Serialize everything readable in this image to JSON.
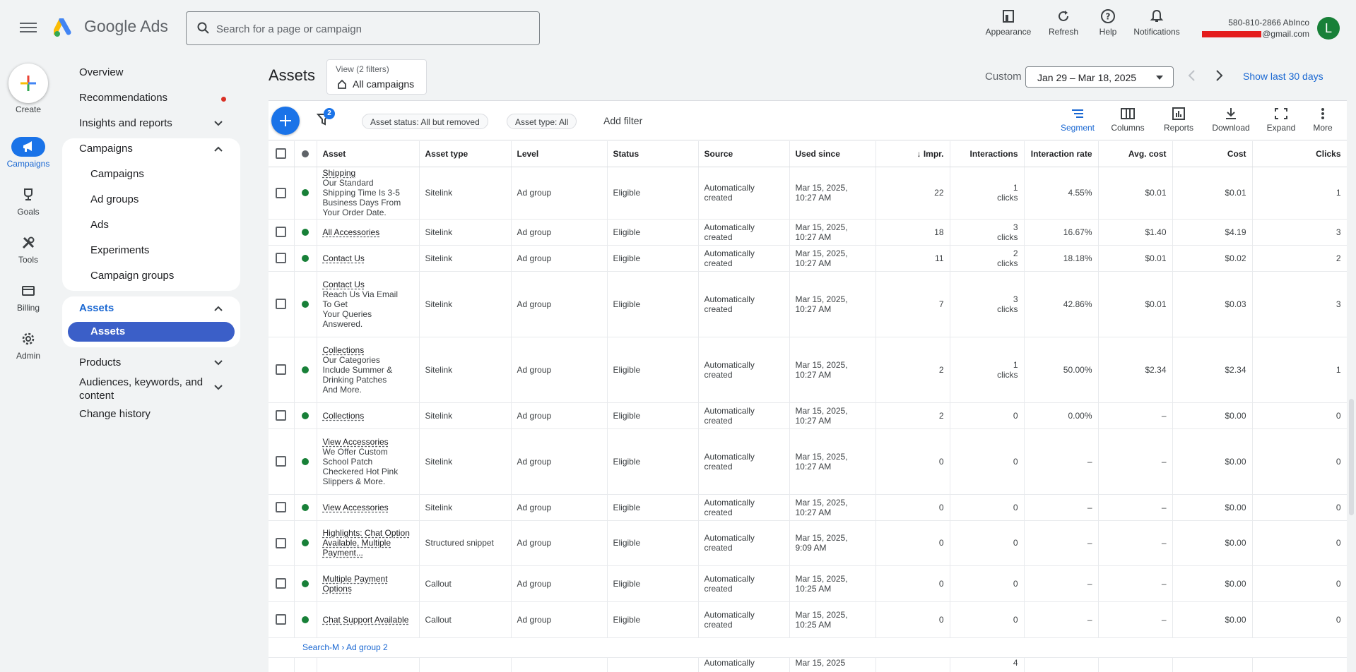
{
  "header": {
    "brand": "Google Ads",
    "search_placeholder": "Search for a page or campaign",
    "buttons": [
      {
        "label": "Appearance",
        "icon": "appearance-icon"
      },
      {
        "label": "Refresh",
        "icon": "refresh-icon"
      },
      {
        "label": "Help",
        "icon": "help-icon"
      },
      {
        "label": "Notifications",
        "icon": "bell-icon"
      }
    ],
    "account_name": "580-810-2866 AbInco",
    "account_email_suffix": "@gmail.com",
    "avatar_letter": "L"
  },
  "rail": {
    "create": "Create",
    "items": [
      {
        "label": "Campaigns",
        "icon": "megaphone-icon",
        "active": true
      },
      {
        "label": "Goals",
        "icon": "trophy-icon"
      },
      {
        "label": "Tools",
        "icon": "tools-icon"
      },
      {
        "label": "Billing",
        "icon": "credit-card-icon"
      },
      {
        "label": "Admin",
        "icon": "gear-icon"
      }
    ]
  },
  "nav": {
    "overview": "Overview",
    "recommendations": "Recommendations",
    "insights": "Insights and reports",
    "campaigns_header": "Campaigns",
    "campaigns_sub": [
      "Campaigns",
      "Ad groups",
      "Ads",
      "Experiments",
      "Campaign groups"
    ],
    "assets_header": "Assets",
    "assets_active": "Assets",
    "products": "Products",
    "audiences": "Audiences, keywords, and content",
    "change_history": "Change history"
  },
  "main": {
    "title": "Assets",
    "view_label": "View (2 filters)",
    "view_value": "All campaigns",
    "custom_label": "Custom",
    "date_range": "Jan 29 – Mar 18, 2025",
    "show_last": "Show last 30 days"
  },
  "toolbar": {
    "filter_count": "2",
    "chips": [
      "Asset status: All but removed",
      "Asset type: All"
    ],
    "add_filter": "Add filter",
    "tools": [
      {
        "label": "Segment",
        "icon": "segment-icon"
      },
      {
        "label": "Columns",
        "icon": "columns-icon"
      },
      {
        "label": "Reports",
        "icon": "reports-icon"
      },
      {
        "label": "Download",
        "icon": "download-icon"
      },
      {
        "label": "Expand",
        "icon": "expand-icon"
      },
      {
        "label": "More",
        "icon": "more-vert-icon"
      }
    ]
  },
  "table": {
    "columns": [
      "Asset",
      "Asset type",
      "Level",
      "Status",
      "Source",
      "Used since",
      "Impr.",
      "Interactions",
      "Interaction rate",
      "Avg. cost",
      "Cost",
      "Clicks"
    ],
    "rows": [
      {
        "asset": "Shipping",
        "desc": [
          "Our Standard",
          "Shipping Time Is 3-5",
          "Business Days From",
          "Your Order Date."
        ],
        "type": "Sitelink",
        "level": "Ad group",
        "status": "Eligible",
        "source": [
          "Automatically",
          "created"
        ],
        "used": [
          "Mar 15, 2025,",
          "10:27 AM"
        ],
        "impr": "22",
        "inter": [
          "1",
          "clicks"
        ],
        "rate": "4.55%",
        "avg": "$0.01",
        "cost": "$0.01",
        "clicks": "1",
        "h": 74
      },
      {
        "asset": "All Accessories",
        "desc": [],
        "type": "Sitelink",
        "level": "Ad group",
        "status": "Eligible",
        "source": [
          "Automatically",
          "created"
        ],
        "used": [
          "Mar 15, 2025,",
          "10:27 AM"
        ],
        "impr": "18",
        "inter": [
          "3",
          "clicks"
        ],
        "rate": "16.67%",
        "avg": "$1.40",
        "cost": "$4.19",
        "clicks": "3",
        "h": 37
      },
      {
        "asset": "Contact Us",
        "desc": [],
        "type": "Sitelink",
        "level": "Ad group",
        "status": "Eligible",
        "source": [
          "Automatically",
          "created"
        ],
        "used": [
          "Mar 15, 2025,",
          "10:27 AM"
        ],
        "impr": "11",
        "inter": [
          "2",
          "clicks"
        ],
        "rate": "18.18%",
        "avg": "$0.01",
        "cost": "$0.02",
        "clicks": "2",
        "h": 37
      },
      {
        "asset": "Contact Us",
        "desc": [
          "Reach Us Via Email",
          "To Get",
          "Your Queries",
          "Answered."
        ],
        "type": "Sitelink",
        "level": "Ad group",
        "status": "Eligible",
        "source": [
          "Automatically",
          "created"
        ],
        "used": [
          "Mar 15, 2025,",
          "10:27 AM"
        ],
        "impr": "7",
        "inter": [
          "3",
          "clicks"
        ],
        "rate": "42.86%",
        "avg": "$0.01",
        "cost": "$0.03",
        "clicks": "3",
        "h": 93
      },
      {
        "asset": "Collections",
        "desc": [
          "Our Categories",
          "Include Summer &",
          "Drinking Patches",
          "And More."
        ],
        "type": "Sitelink",
        "level": "Ad group",
        "status": "Eligible",
        "source": [
          "Automatically",
          "created"
        ],
        "used": [
          "Mar 15, 2025,",
          "10:27 AM"
        ],
        "impr": "2",
        "inter": [
          "1",
          "clicks"
        ],
        "rate": "50.00%",
        "avg": "$2.34",
        "cost": "$2.34",
        "clicks": "1",
        "h": 93
      },
      {
        "asset": "Collections",
        "desc": [],
        "type": "Sitelink",
        "level": "Ad group",
        "status": "Eligible",
        "source": [
          "Automatically",
          "created"
        ],
        "used": [
          "Mar 15, 2025,",
          "10:27 AM"
        ],
        "impr": "2",
        "inter": [
          "0"
        ],
        "rate": "0.00%",
        "avg": "–",
        "cost": "$0.00",
        "clicks": "0",
        "h": 37
      },
      {
        "asset": "View Accessories",
        "desc": [
          "We Offer Custom",
          "School Patch",
          "Checkered Hot Pink",
          "Slippers & More."
        ],
        "type": "Sitelink",
        "level": "Ad group",
        "status": "Eligible",
        "source": [
          "Automatically",
          "created"
        ],
        "used": [
          "Mar 15, 2025,",
          "10:27 AM"
        ],
        "impr": "0",
        "inter": [
          "0"
        ],
        "rate": "–",
        "avg": "–",
        "cost": "$0.00",
        "clicks": "0",
        "h": 93
      },
      {
        "asset": "View Accessories",
        "desc": [],
        "type": "Sitelink",
        "level": "Ad group",
        "status": "Eligible",
        "source": [
          "Automatically",
          "created"
        ],
        "used": [
          "Mar 15, 2025,",
          "10:27 AM"
        ],
        "impr": "0",
        "inter": [
          "0"
        ],
        "rate": "–",
        "avg": "–",
        "cost": "$0.00",
        "clicks": "0",
        "h": 37
      },
      {
        "asset": "Highlights: Chat Option Available, Multiple Payment...",
        "desc": [],
        "type": "Structured snippet",
        "level": "Ad group",
        "status": "Eligible",
        "source": [
          "Automatically",
          "created"
        ],
        "used": [
          "Mar 15, 2025,",
          "9:09 AM"
        ],
        "impr": "0",
        "inter": [
          "0"
        ],
        "rate": "–",
        "avg": "–",
        "cost": "$0.00",
        "clicks": "0",
        "h": 64
      },
      {
        "asset": "Multiple Payment Options",
        "desc": [],
        "type": "Callout",
        "level": "Ad group",
        "status": "Eligible",
        "source": [
          "Automatically",
          "created"
        ],
        "used": [
          "Mar 15, 2025,",
          "10:25 AM"
        ],
        "impr": "0",
        "inter": [
          "0"
        ],
        "rate": "–",
        "avg": "–",
        "cost": "$0.00",
        "clicks": "0",
        "h": 51
      },
      {
        "asset": "Chat Support Available",
        "desc": [],
        "type": "Callout",
        "level": "Ad group",
        "status": "Eligible",
        "source": [
          "Automatically",
          "created"
        ],
        "used": [
          "Mar 15, 2025,",
          "10:25 AM"
        ],
        "impr": "0",
        "inter": [
          "0"
        ],
        "rate": "–",
        "avg": "–",
        "cost": "$0.00",
        "clicks": "0",
        "h": 51
      }
    ],
    "group_row": "Search-M › Ad group 2",
    "partial_row": {
      "source": "Automatically",
      "used": "Mar 15, 2025",
      "inter": "4"
    }
  }
}
